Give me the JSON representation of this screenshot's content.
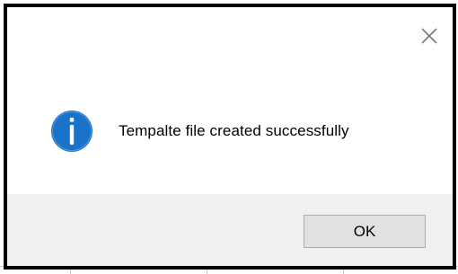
{
  "dialog": {
    "message": "Tempalte file created successfully",
    "ok_label": "OK",
    "icon": "info-icon",
    "close_icon": "close-icon"
  },
  "colors": {
    "info_blue": "#1a73c9",
    "footer_bg": "#f0f0f0",
    "button_bg": "#e1e1e1"
  }
}
